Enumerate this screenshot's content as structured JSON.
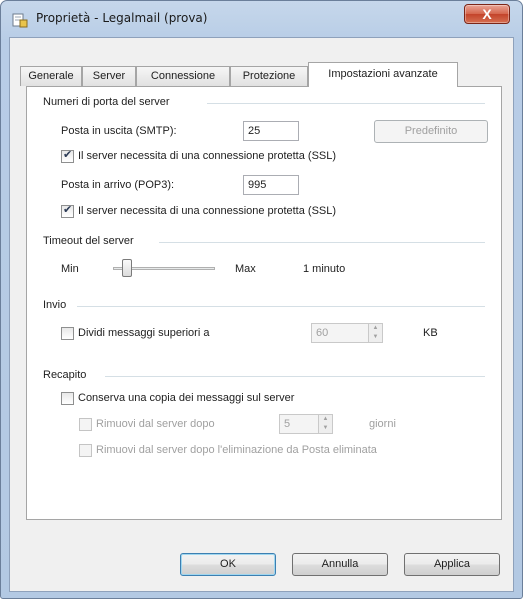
{
  "window": {
    "title": "Proprietà - Legalmail (prova)",
    "close_label": "X"
  },
  "tabs": [
    {
      "label": "Generale"
    },
    {
      "label": "Server"
    },
    {
      "label": "Connessione"
    },
    {
      "label": "Protezione"
    },
    {
      "label": "Impostazioni avanzate"
    }
  ],
  "server_ports": {
    "group_label": "Numeri di porta del server",
    "smtp_label": "Posta in uscita (SMTP):",
    "smtp_value": "25",
    "default_button": "Predefinito",
    "smtp_ssl_label": "Il server necessita di una connessione protetta (SSL)",
    "smtp_ssl_checked": true,
    "pop3_label": "Posta in arrivo (POP3):",
    "pop3_value": "995",
    "pop3_ssl_label": "Il server necessita di una connessione protetta (SSL)",
    "pop3_ssl_checked": true
  },
  "timeout": {
    "group_label": "Timeout del server",
    "min_label": "Min",
    "max_label": "Max",
    "value_label": "1 minuto",
    "slider_fraction": 0.1
  },
  "send": {
    "group_label": "Invio",
    "split_label": "Dividi messaggi superiori a",
    "split_checked": false,
    "split_value": "60",
    "unit_label": "KB"
  },
  "delivery": {
    "group_label": "Recapito",
    "keep_copy_label": "Conserva una copia dei messaggi sul server",
    "keep_copy_checked": false,
    "remove_after_label": "Rimuovi dal server dopo",
    "remove_after_value": "5",
    "days_label": "giorni",
    "remove_deleted_label": "Rimuovi dal server dopo l'eliminazione da Posta eliminata"
  },
  "buttons": {
    "ok": "OK",
    "cancel": "Annulla",
    "apply": "Applica"
  }
}
